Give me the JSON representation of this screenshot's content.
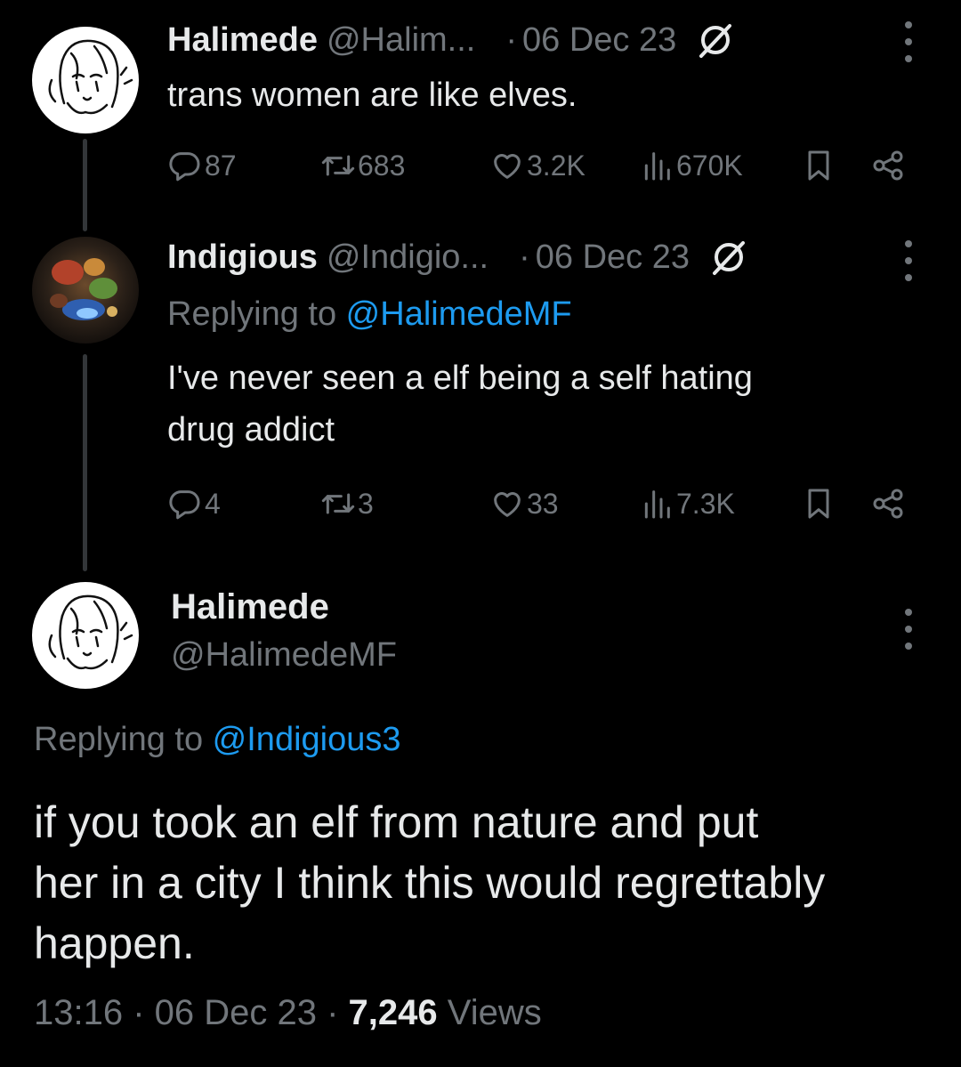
{
  "tweets": [
    {
      "name": "Halimede",
      "handle": "@Halim...",
      "sep": "·",
      "date": "06 Dec 23",
      "text": "trans women are like elves.",
      "replies": "87",
      "retweets": "683",
      "likes": "3.2K",
      "views": "670K"
    },
    {
      "name": "Indigious",
      "handle": "@Indigio...",
      "sep": "·",
      "date": "06 Dec 23",
      "replying_prefix": "Replying to ",
      "replying_handle": "@HalimedeMF",
      "text_line1": "I've never seen a elf being a self hating",
      "text_line2": "drug addict",
      "replies": "4",
      "retweets": "3",
      "likes": "33",
      "views": "7.3K"
    }
  ],
  "main_tweet": {
    "name": "Halimede",
    "handle": "@HalimedeMF",
    "replying_prefix": "Replying to ",
    "replying_handle": "@Indigious3",
    "text_line1": "if you took an elf from nature and put",
    "text_line2": "her in a city I think this would regrettably",
    "text_line3": "happen.",
    "time": "13:16",
    "sep1": " · ",
    "date": "06 Dec 23",
    "sep2": " · ",
    "views_count": "7,246",
    "views_label": " Views"
  },
  "colors": {
    "background": "#000000",
    "text": "#e7e9ea",
    "muted": "#71767b",
    "link": "#1d9bf0",
    "thread_line": "#333639"
  },
  "icons": [
    "reply-icon",
    "retweet-icon",
    "like-icon",
    "views-icon",
    "bookmark-icon",
    "share-icon",
    "more-icon",
    "slash-icon"
  ]
}
